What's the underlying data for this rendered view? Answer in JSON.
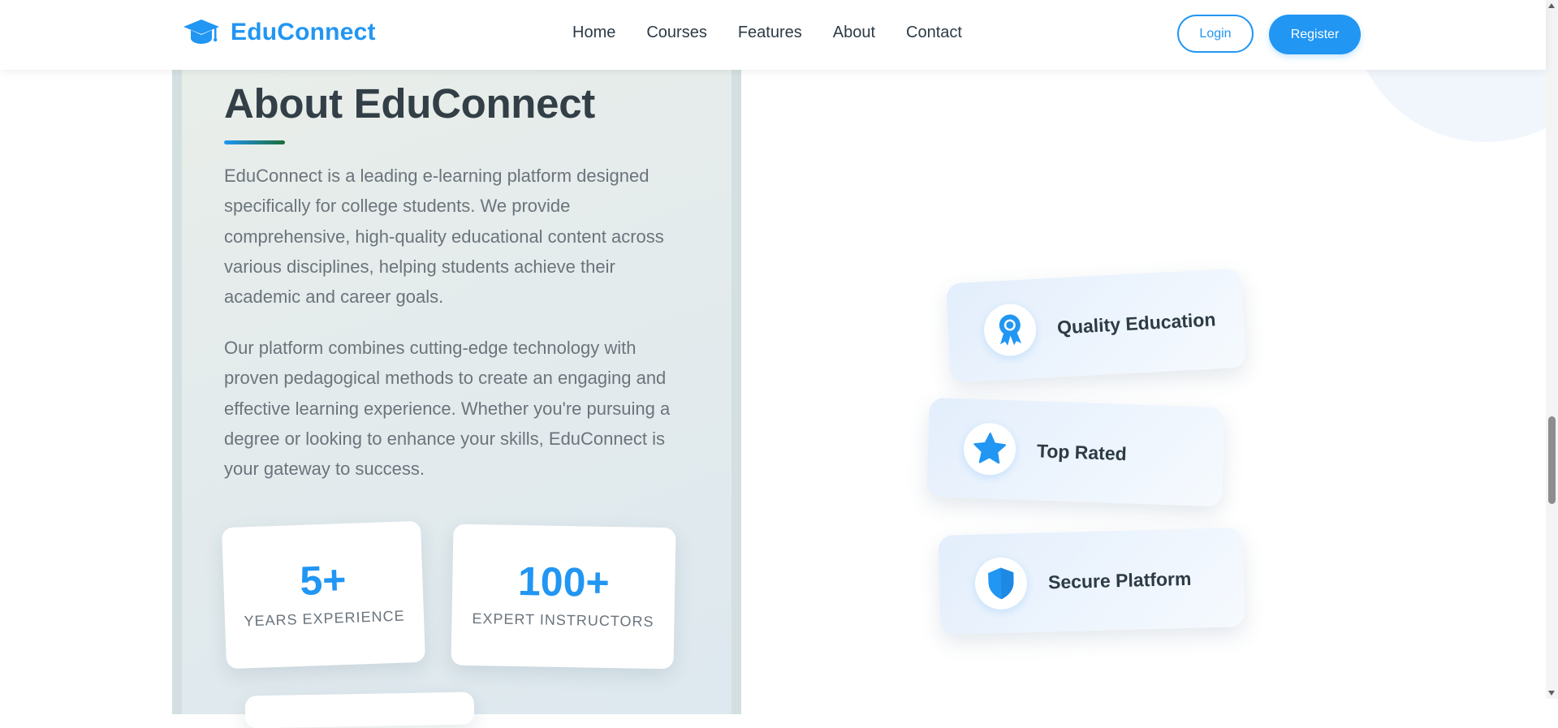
{
  "brand": {
    "name": "EduConnect",
    "icon": "graduation-cap-icon",
    "color": "#2196f3"
  },
  "nav": {
    "items": [
      "Home",
      "Courses",
      "Features",
      "About",
      "Contact"
    ]
  },
  "auth": {
    "login_label": "Login",
    "register_label": "Register"
  },
  "about": {
    "title": "About EduConnect",
    "paragraphs": [
      "EduConnect is a leading e-learning platform designed specifically for college students. We provide comprehensive, high-quality educational content across various disciplines, helping students achieve their academic and career goals.",
      "Our platform combines cutting-edge technology with proven pedagogical methods to create an engaging and effective learning experience. Whether you're pursuing a degree or looking to enhance your skills, EduConnect is your gateway to success."
    ],
    "stats": [
      {
        "value": "5+",
        "label": "YEARS EXPERIENCE"
      },
      {
        "value": "100+",
        "label": "EXPERT INSTRUCTORS"
      }
    ]
  },
  "features": [
    {
      "label": "Quality Education",
      "icon": "award-medal-icon"
    },
    {
      "label": "Top Rated",
      "icon": "star-icon"
    },
    {
      "label": "Secure Platform",
      "icon": "shield-icon"
    }
  ],
  "colors": {
    "accent": "#2196f3",
    "text": "#2d3b45",
    "muted": "#6b747c"
  }
}
